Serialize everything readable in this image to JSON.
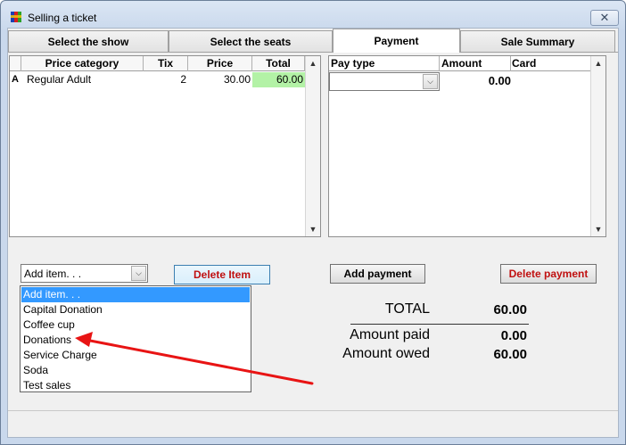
{
  "window": {
    "title": "Selling a ticket",
    "close_glyph": "✕"
  },
  "tabs": [
    {
      "label": "Select the show",
      "active": false
    },
    {
      "label": "Select the seats",
      "active": false
    },
    {
      "label": "Payment",
      "active": true
    },
    {
      "label": "Sale Summary",
      "active": false
    }
  ],
  "items_grid": {
    "columns": [
      "Price category",
      "Tix",
      "Price",
      "Total"
    ],
    "rows": [
      {
        "marker": "A",
        "category": "Regular Adult",
        "tix": "2",
        "price": "30.00",
        "total": "60.00"
      }
    ],
    "total_highlight_color": "#b3f2a6"
  },
  "payment_grid": {
    "columns": [
      "Pay type",
      "Amount",
      "Card"
    ],
    "rows": [
      {
        "pay_type": "",
        "amount": "0.00",
        "card": ""
      }
    ]
  },
  "add_item_combo": {
    "value": "Add item. . ."
  },
  "add_item_dropdown": {
    "options": [
      "Add item. . .",
      "Capital Donation",
      "Coffee cup",
      "Donations",
      "Service Charge",
      "Soda",
      "Test sales"
    ],
    "selected_index": 0
  },
  "buttons": {
    "delete_item": "Delete Item",
    "add_payment": "Add payment",
    "delete_payment": "Delete payment"
  },
  "totals": {
    "total_label": "TOTAL",
    "total_value": "60.00",
    "paid_label": "Amount paid",
    "paid_value": "0.00",
    "owed_label": "Amount owed",
    "owed_value": "60.00"
  },
  "colors": {
    "annotation_arrow": "#e81414",
    "delete_text": "#c01010",
    "selection": "#3399ff"
  },
  "icons": [
    "app-icon",
    "close-icon",
    "scroll-up-icon",
    "scroll-down-icon",
    "chevron-down-icon",
    "annotation-arrow"
  ]
}
